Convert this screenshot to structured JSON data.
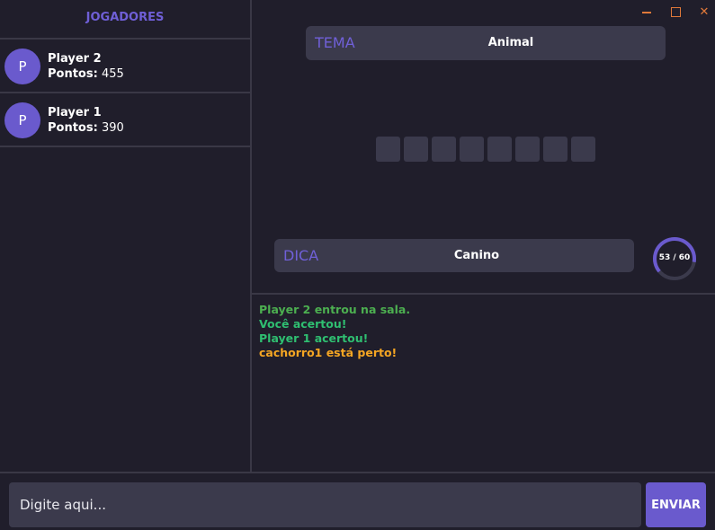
{
  "sidebar": {
    "title": "JOGADORES",
    "players": [
      {
        "avatar": "P",
        "name": "Player 2",
        "points_label": "Pontos:",
        "points": "455"
      },
      {
        "avatar": "P",
        "name": "Player 1",
        "points_label": "Pontos:",
        "points": "390"
      }
    ]
  },
  "window_controls": {
    "minimize_icon": "minimize-icon",
    "maximize_icon": "maximize-icon",
    "close_icon": "close-icon",
    "close_glyph": "✕",
    "color": "#e0793a"
  },
  "game": {
    "theme_label": "TEMA",
    "theme_value": "Animal",
    "hint_label": "DICA",
    "hint_value": "Canino",
    "word_slots": [
      "",
      "",
      "",
      "",
      "",
      "",
      "",
      ""
    ],
    "timer": {
      "remaining": 53,
      "total": 60,
      "text": "53 / 60"
    }
  },
  "chat": {
    "messages": [
      {
        "text": "Player 2 entrou na sala.",
        "color": "#4caf50"
      },
      {
        "text": "Você acertou!",
        "color": "#2fbf71"
      },
      {
        "text": "Player 1 acertou!",
        "color": "#2fbf71"
      },
      {
        "text": "cachorro1 está perto!",
        "color": "#f5a623"
      }
    ],
    "input_placeholder": "Digite aqui...",
    "input_value": "",
    "send_label": "ENVIAR"
  },
  "colors": {
    "background": "#201e2b",
    "panel": "#3b3a4c",
    "accent": "#6a5acd",
    "label_accent": "#7060d8",
    "divider": "#3a3846"
  }
}
